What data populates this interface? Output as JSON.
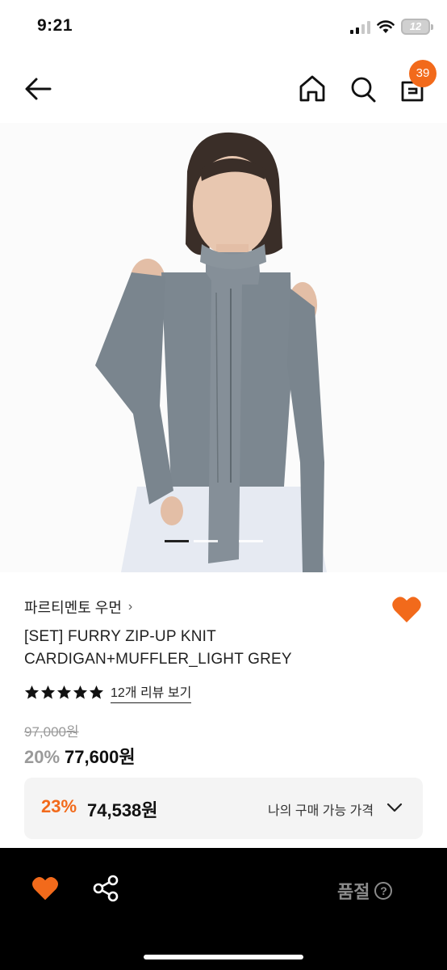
{
  "status_bar": {
    "time": "9:21",
    "battery": "12"
  },
  "nav": {
    "cart_count": "39"
  },
  "product": {
    "brand": "파르티멘토 우먼",
    "title": "[SET] FURRY ZIP-UP KNIT CARDIGAN+MUFFLER_LIGHT GREY",
    "rating": 5,
    "review_link": "12개 리뷰 보기",
    "original_price": "97,000원",
    "discount_rate": "20%",
    "sale_price": "77,600원",
    "image_count": 3,
    "active_image": 1
  },
  "coupon": {
    "rate": "23%",
    "price": "74,538원",
    "label": "나의 구매 가능 가격"
  },
  "bottom_bar": {
    "soldout_label": "품절",
    "help_icon": "?"
  },
  "colors": {
    "accent": "#f26a1b",
    "heart": "#f26a1b",
    "bottom_bar": "#000000"
  }
}
